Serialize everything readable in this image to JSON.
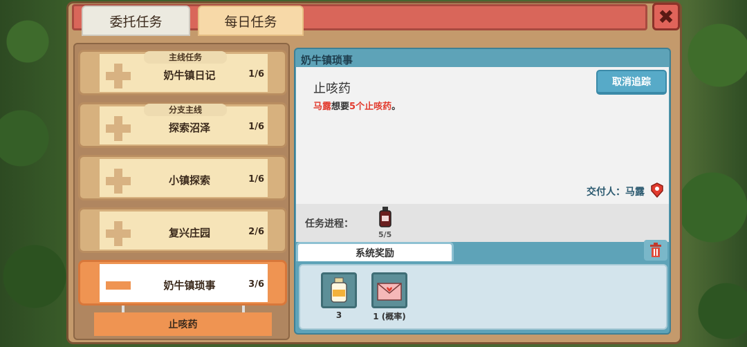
{
  "tabs": [
    {
      "label": "委托任务",
      "active": true
    },
    {
      "label": "每日任务",
      "active": false
    }
  ],
  "close_label": "✖",
  "quests": [
    {
      "tag": "主线任务",
      "title": "奶牛镇日记",
      "count": "1/6"
    },
    {
      "tag": "分支主线",
      "title": "探索沼泽",
      "count": "1/6"
    },
    {
      "tag": "",
      "title": "小镇探索",
      "count": "1/6"
    },
    {
      "tag": "",
      "title": "复兴庄园",
      "count": "2/6"
    },
    {
      "tag": "",
      "title": "奶牛镇琐事",
      "count": "3/6"
    }
  ],
  "sub_item": "止咳药",
  "detail": {
    "header": "奶牛镇琐事",
    "title": "止咳药",
    "desc_name": "马露",
    "desc_mid": "想要",
    "desc_item": "5个止咳药",
    "desc_end": "。",
    "untrack_label": "取消追踪",
    "giver_label": "交付人：马露"
  },
  "progress": {
    "label": "任务进程：",
    "count": "5/5"
  },
  "rewards": {
    "tab_label": "系统奖励",
    "items": [
      {
        "icon": "milk-bottle-icon",
        "label": "3"
      },
      {
        "icon": "love-letter-icon",
        "label": "1 (概率)"
      }
    ]
  },
  "colors": {
    "active_orange": "#ef9452",
    "accent_blue": "#5ea3b8",
    "highlight_red": "#e23b2e"
  }
}
